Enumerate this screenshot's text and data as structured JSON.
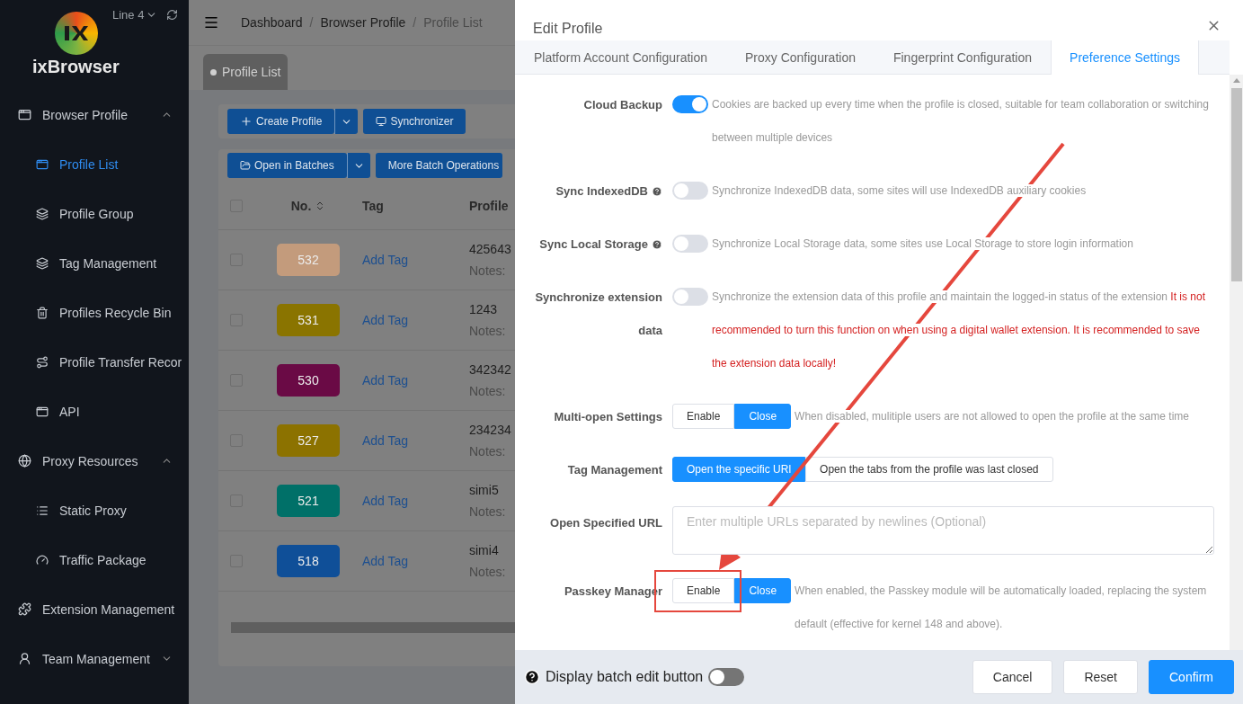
{
  "sidebar": {
    "brand": "ixBrowser",
    "line": "Line 4",
    "items": [
      {
        "label": "Browser Profile",
        "expanded": true,
        "children": [
          {
            "label": "Profile List",
            "selected": true
          },
          {
            "label": "Profile Group",
            "selected": false
          },
          {
            "label": "Tag Management",
            "selected": false
          },
          {
            "label": "Profiles Recycle Bin",
            "selected": false
          },
          {
            "label": "Profile Transfer Recor",
            "selected": false
          },
          {
            "label": "API",
            "selected": false
          }
        ]
      },
      {
        "label": "Proxy Resources",
        "expanded": true,
        "children": [
          {
            "label": "Static Proxy",
            "selected": false
          },
          {
            "label": "Traffic Package",
            "selected": false
          }
        ]
      },
      {
        "label": "Extension Management"
      },
      {
        "label": "Team Management",
        "expanded": false
      }
    ]
  },
  "main": {
    "breadcrumb": [
      "Dashboard",
      "Browser Profile",
      "Profile List"
    ],
    "breadcrumb_separator": "/",
    "page_tab": "Profile List",
    "toolbar_top": [
      {
        "label": "Create Profile",
        "kind": "split"
      },
      {
        "label": "Synchronizer",
        "kind": "plain"
      }
    ],
    "toolbar_batch": [
      {
        "label": "Open in Batches",
        "kind": "split"
      },
      {
        "label": "More Batch Operations",
        "kind": "dropdown"
      }
    ],
    "table": {
      "columns": [
        "No.",
        "Tag",
        "Profile"
      ],
      "all_checked": false,
      "rows": [
        {
          "checked": false,
          "number": "532",
          "color": "#c39b7c",
          "tag": "Add Tag",
          "name": "425643",
          "notes": "Notes:"
        },
        {
          "checked": false,
          "number": "531",
          "color": "#8a7400",
          "tag": "Add Tag",
          "name": "1243",
          "notes": "Notes:"
        },
        {
          "checked": false,
          "number": "530",
          "color": "#6a0a45",
          "tag": "Add Tag",
          "name": "342342",
          "notes": "Notes:"
        },
        {
          "checked": false,
          "number": "527",
          "color": "#8c7200",
          "tag": "Add Tag",
          "name": "234234",
          "notes": "Notes:"
        },
        {
          "checked": false,
          "number": "521",
          "color": "#007068",
          "tag": "Add Tag",
          "name": "simi5",
          "notes": "Notes:"
        },
        {
          "checked": false,
          "number": "518",
          "color": "#0f4f98",
          "tag": "Add Tag",
          "name": "simi4",
          "notes": "Notes:"
        }
      ]
    }
  },
  "drawer": {
    "title": "Edit Profile",
    "tabs": [
      {
        "label": "Platform Account Configuration",
        "selected": false
      },
      {
        "label": "Proxy Configuration",
        "selected": false
      },
      {
        "label": "Fingerprint Configuration",
        "selected": false
      },
      {
        "label": "Preference Settings",
        "selected": true
      }
    ],
    "settings": [
      {
        "kind": "switch",
        "label": "Cloud Backup",
        "help": false,
        "on": true,
        "description": "Cookies are backed up every time when the profile is closed, suitable for team collaboration or switching between multiple devices"
      },
      {
        "kind": "switch",
        "label": "Sync IndexedDB",
        "help": true,
        "on": false,
        "description": "Synchronize IndexedDB data, some sites will use IndexedDB auxiliary cookies"
      },
      {
        "kind": "switch",
        "label": "Sync Local Storage",
        "help": true,
        "on": false,
        "description": "Synchronize Local Storage data, some sites use Local Storage to store login information"
      },
      {
        "kind": "switch",
        "label": "Synchronize extension data",
        "help": false,
        "on": false,
        "description": "Synchronize the extension data of this profile and maintain the logged-in status of the extension",
        "warning": "It is not recommended to turn this function on when using a digital wallet extension. It is recommended to save the extension data locally!"
      },
      {
        "kind": "segmented",
        "label": "Multi-open Settings",
        "options": [
          {
            "label": "Enable",
            "selected": false
          },
          {
            "label": "Close",
            "selected": true
          }
        ],
        "description": "When disabled, mulitiple users are not allowed to open the profile at the same time"
      },
      {
        "kind": "segmented",
        "label": "Tag Management",
        "options": [
          {
            "label": "Open the specific URl",
            "selected": true
          },
          {
            "label": "Open the tabs from the profile was last closed",
            "selected": false
          }
        ]
      },
      {
        "kind": "textarea",
        "label": "Open Specified URL",
        "placeholder": "Enter multiple URLs separated by newlines (Optional)"
      },
      {
        "kind": "segmented",
        "label": "Passkey Manager",
        "options": [
          {
            "label": "Enable",
            "selected": false
          },
          {
            "label": "Close",
            "selected": true
          }
        ],
        "description": "When enabled, the Passkey module will be automatically loaded, replacing the system default (effective for kernel 148 and above)."
      }
    ],
    "footer": {
      "batch_edit_label": "Display batch edit button",
      "batch_edit_on": false,
      "buttons": [
        {
          "label": "Cancel",
          "kind": "default"
        },
        {
          "label": "Reset",
          "kind": "default"
        },
        {
          "label": "Confirm",
          "kind": "primary"
        }
      ]
    }
  }
}
